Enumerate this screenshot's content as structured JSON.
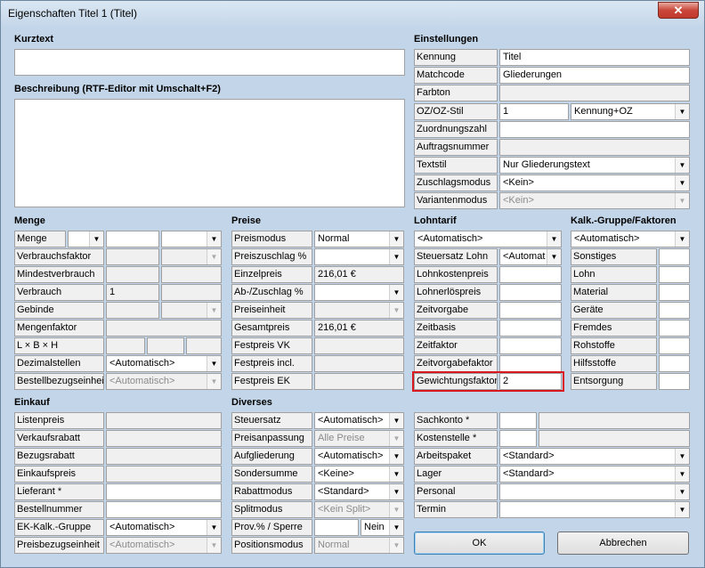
{
  "window": {
    "title": "Eigenschaften Titel 1 (Titel)",
    "close_label": "✕"
  },
  "kurztext": {
    "heading": "Kurztext",
    "value": ""
  },
  "beschreibung": {
    "heading": "Beschreibung (RTF-Editor mit Umschalt+F2)",
    "value": ""
  },
  "einstellungen": {
    "heading": "Einstellungen",
    "kennung_label": "Kennung",
    "kennung_value": "Titel",
    "matchcode_label": "Matchcode",
    "matchcode_value": "Gliederungen",
    "farbton_label": "Farbton",
    "ozstil_label": "OZ/OZ-Stil",
    "ozstil_value": "1",
    "ozstil_select": "Kennung+OZ",
    "zuordnungszahl_label": "Zuordnungszahl",
    "auftragsnummer_label": "Auftragsnummer",
    "textstil_label": "Textstil",
    "textstil_value": "Nur Gliederungstext",
    "zuschlagsmodus_label": "Zuschlagsmodus",
    "zuschlagsmodus_value": "<Kein>",
    "variantenmodus_label": "Variantenmodus",
    "variantenmodus_value": "<Kein>"
  },
  "menge": {
    "heading": "Menge",
    "menge_label": "Menge",
    "verbrauchsfaktor_label": "Verbrauchsfaktor",
    "mindestverbrauch_label": "Mindestverbrauch",
    "verbrauch_label": "Verbrauch",
    "verbrauch_value": "1",
    "gebinde_label": "Gebinde",
    "mengenfaktor_label": "Mengenfaktor",
    "lbh_label": "L × B × H",
    "dezimalstellen_label": "Dezimalstellen",
    "dezimalstellen_value": "<Automatisch>",
    "bestellbezug_label": "Bestellbezugseinheit",
    "bestellbezug_value": "<Automatisch>"
  },
  "preise": {
    "heading": "Preise",
    "preismodus_label": "Preismodus",
    "preismodus_value": "Normal",
    "preiszuschlag_label": "Preiszuschlag %",
    "einzelpreis_label": "Einzelpreis",
    "einzelpreis_value": "216,01 €",
    "abzuschlag_label": "Ab-/Zuschlag %",
    "preiseinheit_label": "Preiseinheit",
    "gesamtpreis_label": "Gesamtpreis",
    "gesamtpreis_value": "216,01 €",
    "festpreis_vk_label": "Festpreis VK",
    "festpreis_incl_label": "Festpreis incl.",
    "festpreis_ek_label": "Festpreis EK"
  },
  "lohntarif": {
    "heading": "Lohntarif",
    "select_value": "<Automatisch>",
    "steuersatz_label": "Steuersatz Lohn",
    "steuersatz_value": "<Automat",
    "lohnkostenpreis_label": "Lohnkostenpreis",
    "lohnerloespreis_label": "Lohnerlöspreis",
    "zeitvorgabe_label": "Zeitvorgabe",
    "zeitbasis_label": "Zeitbasis",
    "zeitfaktor_label": "Zeitfaktor",
    "zeitvorgabefaktor_label": "Zeitvorgabefaktor",
    "gewichtungsfaktor_label": "Gewichtungsfaktor",
    "gewichtungsfaktor_value": "2"
  },
  "kalk": {
    "heading": "Kalk.-Gruppe/Faktoren",
    "select_value": "<Automatisch>",
    "rows": [
      "Sonstiges",
      "Lohn",
      "Material",
      "Geräte",
      "Fremdes",
      "Rohstoffe",
      "Hilfsstoffe",
      "Entsorgung"
    ]
  },
  "einkauf": {
    "heading": "Einkauf",
    "listenpreis_label": "Listenpreis",
    "verkaufsrabatt_label": "Verkaufsrabatt",
    "bezugsrabatt_label": "Bezugsrabatt",
    "einkaufspreis_label": "Einkaufspreis",
    "lieferant_label": "Lieferant *",
    "bestellnummer_label": "Bestellnummer",
    "ekgruppe_label": "EK-Kalk.-Gruppe",
    "ekgruppe_value": "<Automatisch>",
    "preisbezug_label": "Preisbezugseinheit",
    "preisbezug_value": "<Automatisch>"
  },
  "diverses": {
    "heading": "Diverses",
    "steuersatz_label": "Steuersatz",
    "steuersatz_value": "<Automatisch>",
    "preisanpassung_label": "Preisanpassung",
    "preisanpassung_value": "Alle Preise",
    "aufgliederung_label": "Aufgliederung",
    "aufgliederung_value": "<Automatisch>",
    "sondersumme_label": "Sondersumme",
    "sondersumme_value": "<Keine>",
    "rabattmodus_label": "Rabattmodus",
    "rabattmodus_value": "<Standard>",
    "splitmodus_label": "Splitmodus",
    "splitmodus_value": "<Kein Split>",
    "prov_label": "Prov.% / Sperre",
    "prov_select": "Nein",
    "positionsmodus_label": "Positionsmodus",
    "positionsmodus_value": "Normal"
  },
  "konten": {
    "sachkonto_label": "Sachkonto *",
    "kostenstelle_label": "Kostenstelle *",
    "arbeitspaket_label": "Arbeitspaket",
    "arbeitspaket_value": "<Standard>",
    "lager_label": "Lager",
    "lager_value": "<Standard>",
    "personal_label": "Personal",
    "termin_label": "Termin"
  },
  "buttons": {
    "ok": "OK",
    "abbrechen": "Abbrechen"
  },
  "arrow_glyph": "▼"
}
